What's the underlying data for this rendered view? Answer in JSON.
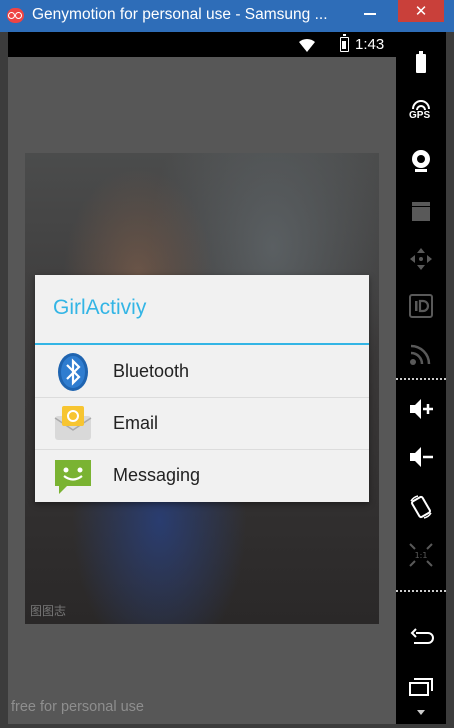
{
  "window": {
    "title": "Genymotion for personal use - Samsung ...",
    "close_glyph": "✕",
    "accent": "#2e6db8"
  },
  "statusbar": {
    "time": "1:43",
    "icons": [
      "wifi-icon",
      "battery-charging-icon"
    ]
  },
  "dialog": {
    "title": "GirlActiviy",
    "title_color": "#33b5e5",
    "items": [
      {
        "label": "Bluetooth",
        "icon": "bluetooth-icon"
      },
      {
        "label": "Email",
        "icon": "email-icon"
      },
      {
        "label": "Messaging",
        "icon": "messaging-icon"
      }
    ]
  },
  "panel": {
    "gps_label": "GPS",
    "buttons": [
      "battery-icon",
      "gps-icon",
      "camera-icon",
      "video-icon",
      "dpad-icon",
      "id-icon",
      "rss-icon",
      "volume-up-icon",
      "volume-down-icon",
      "rotate-icon",
      "pixel-ratio-icon",
      "back-icon",
      "recent-apps-icon"
    ]
  },
  "footer": {
    "free_label": "free for personal use",
    "photo_watermark": "图图志"
  }
}
